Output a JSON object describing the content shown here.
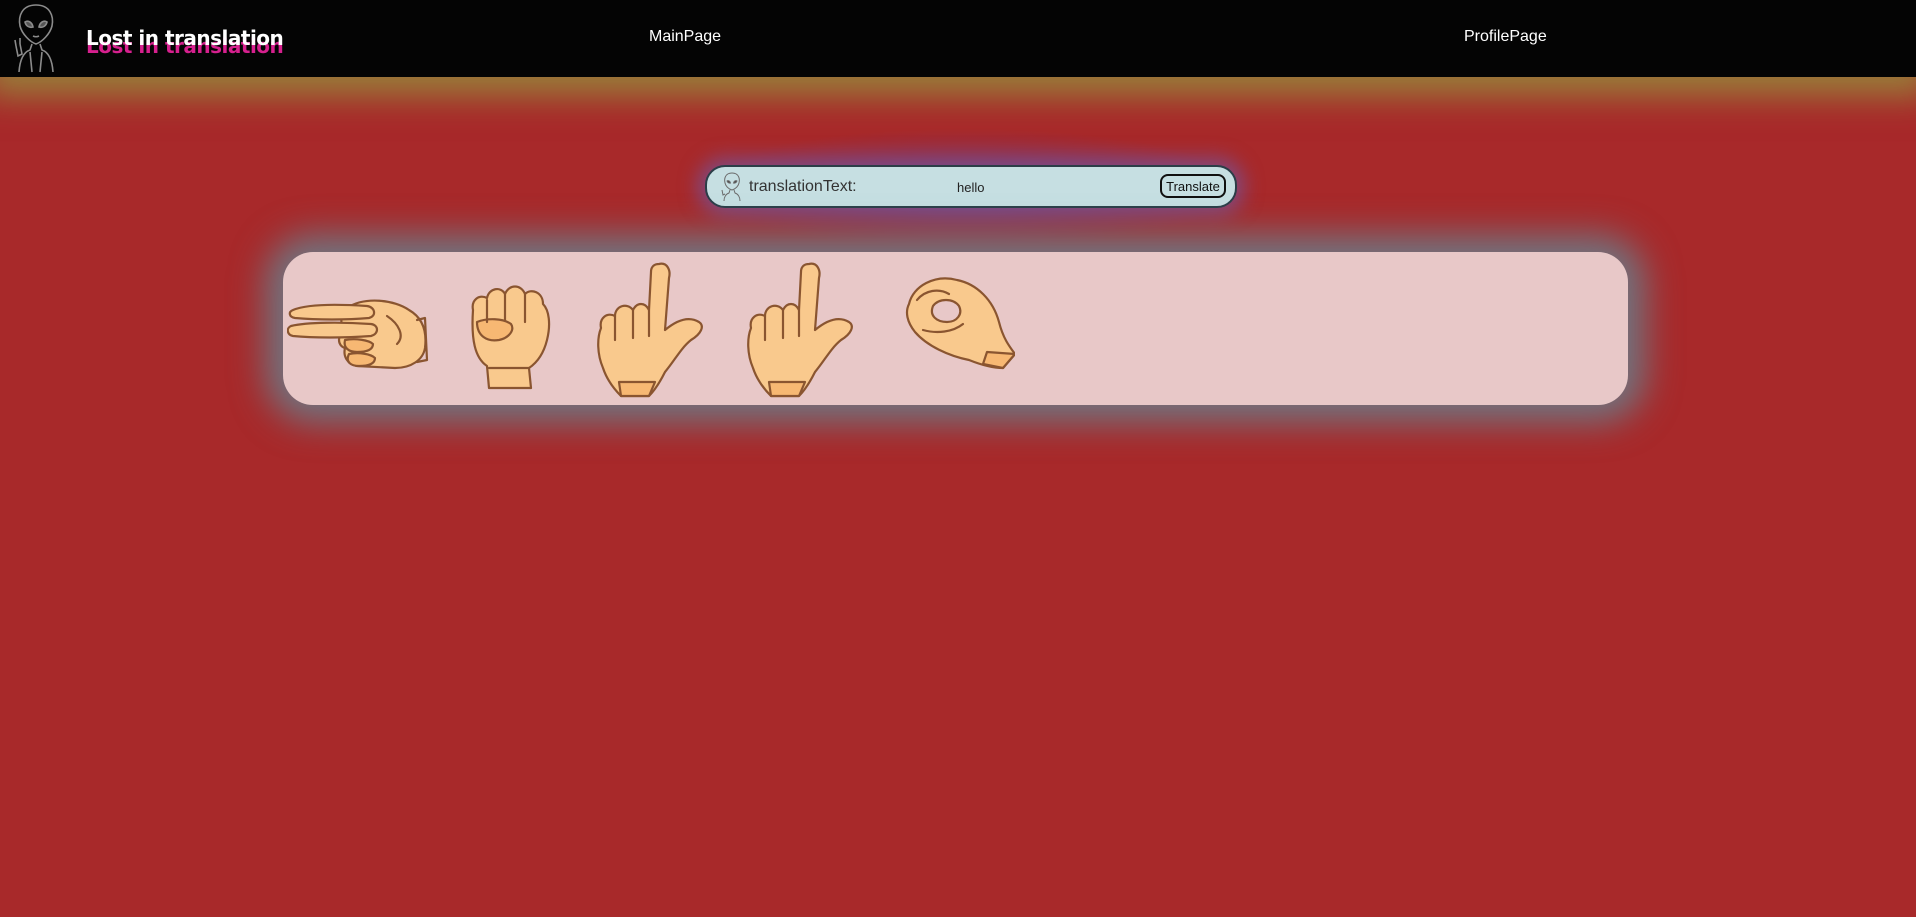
{
  "navbar": {
    "brand": "Lost in translation",
    "links": [
      "MainPage",
      "ProfilePage"
    ]
  },
  "translation": {
    "label": "translationText:",
    "input_value": "hello",
    "button_label": "Translate"
  },
  "signs": [
    {
      "letter": "h",
      "icon": "hand-sign-h-icon"
    },
    {
      "letter": "e",
      "icon": "hand-sign-e-icon"
    },
    {
      "letter": "l",
      "icon": "hand-sign-l-icon"
    },
    {
      "letter": "l",
      "icon": "hand-sign-l-icon"
    },
    {
      "letter": "o",
      "icon": "hand-sign-o-icon"
    }
  ],
  "colors": {
    "background": "#a8292a",
    "navbar": "#040404",
    "brand_accent": "#d6208e",
    "bar": "#c6dfe2",
    "panel": "#e8c8c8",
    "skin": "#f9c98d",
    "outline": "#8a5530"
  }
}
